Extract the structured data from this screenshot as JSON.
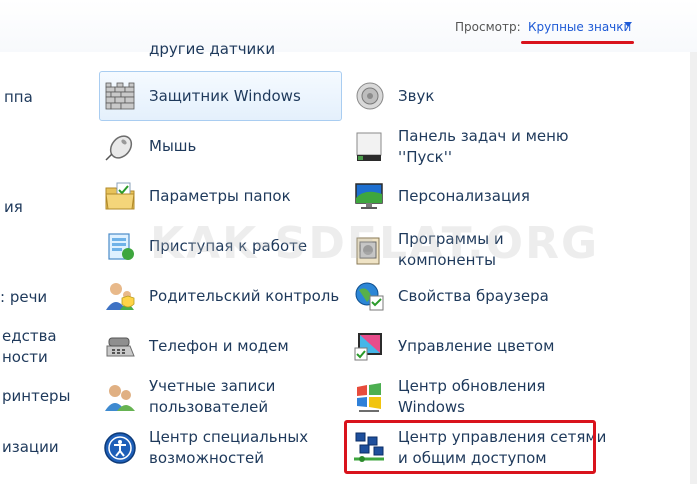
{
  "header": {
    "view_label": "Просмотр:",
    "view_value": "Крупные значки"
  },
  "left_fragments": [
    "ппа",
    "ия",
    ": речи",
    "едства",
    "ности",
    "ринтеры",
    "изации"
  ],
  "column1": [
    {
      "label": "другие датчики",
      "icon": "sensor-icon"
    },
    {
      "label": "Защитник Windows",
      "icon": "defender-wall-icon"
    },
    {
      "label": "Мышь",
      "icon": "mouse-icon"
    },
    {
      "label": "Параметры папок",
      "icon": "folder-options-icon"
    },
    {
      "label": "Приступая к работе",
      "icon": "getting-started-icon"
    },
    {
      "label": "Родительский контроль",
      "icon": "parental-control-icon"
    },
    {
      "label": "Телефон и модем",
      "icon": "phone-modem-icon"
    },
    {
      "label": "Учетные записи\nпользователей",
      "icon": "user-accounts-icon"
    },
    {
      "label": "Центр специальных\nвозможностей",
      "icon": "accessibility-icon"
    }
  ],
  "column2": [
    {
      "label": "Звук",
      "icon": "speaker-icon"
    },
    {
      "label": "Панель задач и меню\n''Пуск''",
      "icon": "taskbar-icon"
    },
    {
      "label": "Персонализация",
      "icon": "personalization-icon"
    },
    {
      "label": "Программы и\nкомпоненты",
      "icon": "programs-icon"
    },
    {
      "label": "Свойства браузера",
      "icon": "internet-options-icon"
    },
    {
      "label": "Управление цветом",
      "icon": "color-management-icon"
    },
    {
      "label": "Центр обновления\nWindows",
      "icon": "windows-update-icon"
    },
    {
      "label": "Центр управления сетями\nи общим доступом",
      "icon": "network-center-icon"
    }
  ],
  "watermark": "KAK-SDELAT.ORG",
  "colors": {
    "link": "#1e5ad6",
    "text": "#1e395b",
    "highlight": "#d9131c"
  }
}
